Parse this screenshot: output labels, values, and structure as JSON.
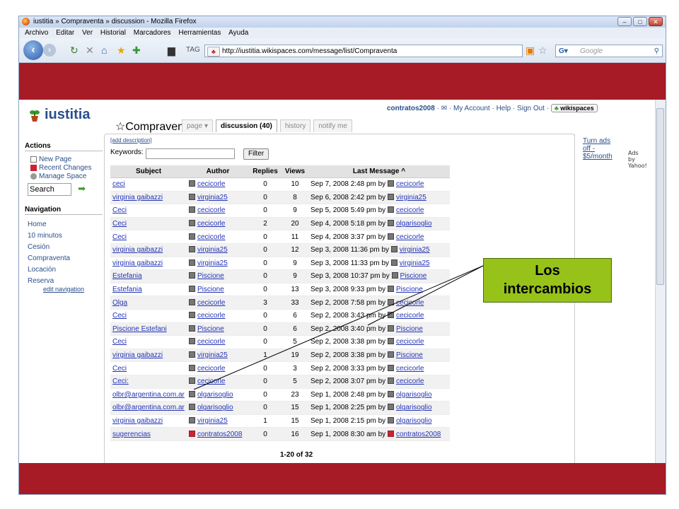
{
  "window": {
    "title": "iustitia » Compraventa » discussion - Mozilla Firefox"
  },
  "menubar": [
    "Archivo",
    "Editar",
    "Ver",
    "Historial",
    "Marcadores",
    "Herramientas",
    "Ayuda"
  ],
  "url": "http://iustitia.wikispaces.com/message/list/Compraventa",
  "search_placeholder": "Google",
  "site": {
    "logo": "iustitia",
    "top": {
      "user": "contratos2008",
      "my_account": "My Account",
      "help": "Help",
      "sign_out": "Sign Out",
      "wikispaces": "wikispaces"
    }
  },
  "sidebar": {
    "actions_heading": "Actions",
    "actions": [
      "New Page",
      "Recent Changes",
      "Manage Space"
    ],
    "search_value": "Search",
    "navigation_heading": "Navigation",
    "nav": [
      "Home",
      "10 minutos",
      "Cesión",
      "Compraventa",
      "Locación",
      "Reserva"
    ],
    "edit_navigation": "edit navigation"
  },
  "page": {
    "title": "Compraventa",
    "tabs": [
      "page ▾",
      "discussion (40)",
      "history",
      "notify me"
    ],
    "add_description": "[add description]",
    "keywords_label": "Keywords:",
    "filter_label": "Filter",
    "pager": "1-20 of 32"
  },
  "ads": {
    "link": "Turn ads off - $5/month",
    "by": "Ads by Yahoo!"
  },
  "table": {
    "headers": [
      "Subject",
      "Author",
      "Replies",
      "Views",
      "Last Message ^"
    ],
    "rows": [
      {
        "subject": "ceci",
        "author": "cecicorle",
        "replies": "0",
        "views": "10",
        "date": "Sep 7, 2008 2:48 pm by",
        "by": "cecicorle"
      },
      {
        "subject": "virginia gaibazzi",
        "author": "virginia25",
        "replies": "0",
        "views": "8",
        "date": "Sep 6, 2008 2:42 pm by",
        "by": "virginia25"
      },
      {
        "subject": "Ceci",
        "author": "cecicorle",
        "replies": "0",
        "views": "9",
        "date": "Sep 5, 2008 5:49 pm by",
        "by": "cecicorle"
      },
      {
        "subject": "Ceci",
        "author": "cecicorle",
        "replies": "2",
        "views": "20",
        "date": "Sep 4, 2008 5:18 pm by",
        "by": "olgarisoglio"
      },
      {
        "subject": "Ceci",
        "author": "cecicorle",
        "replies": "0",
        "views": "11",
        "date": "Sep 4, 2008 3:37 pm by",
        "by": "cecicorle"
      },
      {
        "subject": "virginia gaibazzi",
        "author": "virginia25",
        "replies": "0",
        "views": "12",
        "date": "Sep 3, 2008 11:36 pm by",
        "by": "virginia25"
      },
      {
        "subject": "virginia gaibazzi",
        "author": "virginia25",
        "replies": "0",
        "views": "9",
        "date": "Sep 3, 2008 11:33 pm by",
        "by": "virginia25"
      },
      {
        "subject": "Estefania",
        "author": "Piscione",
        "replies": "0",
        "views": "9",
        "date": "Sep 3, 2008 10:37 pm by",
        "by": "Piscione"
      },
      {
        "subject": "Estefania",
        "author": "Piscione",
        "replies": "0",
        "views": "13",
        "date": "Sep 3, 2008 9:33 pm by",
        "by": "Piscione"
      },
      {
        "subject": "Olga",
        "author": "cecicorle",
        "replies": "3",
        "views": "33",
        "date": "Sep 2, 2008 7:58 pm by",
        "by": "cecicorle"
      },
      {
        "subject": "Ceci",
        "author": "cecicorle",
        "replies": "0",
        "views": "6",
        "date": "Sep 2, 2008 3:43 pm by",
        "by": "cecicorle"
      },
      {
        "subject": "Piscione Estefani",
        "author": "Piscione",
        "replies": "0",
        "views": "6",
        "date": "Sep 2, 2008 3:40 pm by",
        "by": "Piscione"
      },
      {
        "subject": "Ceci",
        "author": "cecicorle",
        "replies": "0",
        "views": "5",
        "date": "Sep 2, 2008 3:38 pm by",
        "by": "cecicorle"
      },
      {
        "subject": "virginia gaibazzi",
        "author": "virginia25",
        "replies": "1",
        "views": "19",
        "date": "Sep 2, 2008 3:38 pm by",
        "by": "Piscione"
      },
      {
        "subject": "Ceci",
        "author": "cecicorle",
        "replies": "0",
        "views": "3",
        "date": "Sep 2, 2008 3:33 pm by",
        "by": "cecicorle"
      },
      {
        "subject": "Ceci:",
        "author": "cecicorle",
        "replies": "0",
        "views": "5",
        "date": "Sep 2, 2008 3:07 pm by",
        "by": "cecicorle"
      },
      {
        "subject": "olbr@argentina.com.ar",
        "author": "olgarisoglio",
        "replies": "0",
        "views": "23",
        "date": "Sep 1, 2008 2:48 pm by",
        "by": "olgarisoglio"
      },
      {
        "subject": "olbr@argentina.com.ar",
        "author": "olgarisoglio",
        "replies": "0",
        "views": "15",
        "date": "Sep 1, 2008 2:25 pm by",
        "by": "olgarisoglio"
      },
      {
        "subject": "virginia gaibazzi",
        "author": "virginia25",
        "replies": "1",
        "views": "15",
        "date": "Sep 1, 2008 2:15 pm by",
        "by": "olgarisoglio"
      },
      {
        "subject": "sugerencias",
        "author": "contratos2008",
        "replies": "0",
        "views": "16",
        "date": "Sep 1, 2008 8:30 am by",
        "by": "contratos2008"
      }
    ]
  },
  "callout": {
    "line1": "Los",
    "line2": "intercambios"
  },
  "colors": {
    "band": "#a61b26",
    "callout": "#97c21a",
    "link": "#2434b4"
  }
}
